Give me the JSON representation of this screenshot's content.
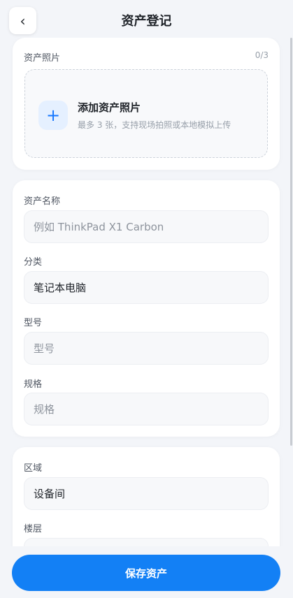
{
  "header": {
    "back_icon": "chevron-left-icon",
    "back_glyph": "‹",
    "title": "资产登记"
  },
  "photos": {
    "label": "资产照片",
    "count": "0/3",
    "add_glyph": "+",
    "add_title": "添加资产照片",
    "add_hint": "最多 3 张，支持现场拍照或本地模拟上传"
  },
  "info": {
    "name_label": "资产名称",
    "name_placeholder": "例如 ThinkPad X1 Carbon",
    "category_label": "分类",
    "category_value": "笔记本电脑",
    "model_label": "型号",
    "model_placeholder": "型号",
    "spec_label": "规格",
    "spec_placeholder": "规格"
  },
  "location": {
    "area_label": "区域",
    "area_value": "设备间",
    "floor_label": "楼层"
  },
  "footer": {
    "save_label": "保存资产"
  },
  "colors": {
    "primary": "#1380f5",
    "background": "#f3f5f9",
    "card": "#ffffff"
  }
}
